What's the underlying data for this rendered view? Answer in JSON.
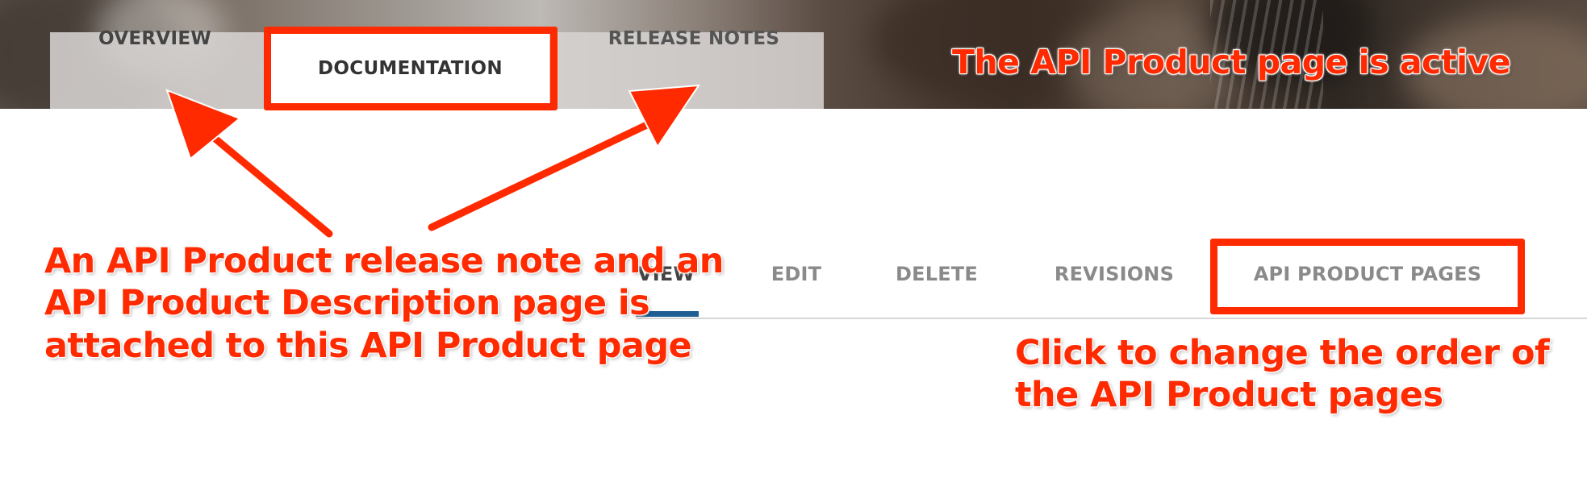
{
  "top_tabs": {
    "overview": "OVERVIEW",
    "documentation": "DOCUMENTATION",
    "release_notes": "RELEASE NOTES"
  },
  "secondary_tabs": {
    "view": "VIEW",
    "edit": "EDIT",
    "delete": "DELETE",
    "revisions": "REVISIONS",
    "api_product_pages": "API PRODUCT PAGES"
  },
  "annotations": {
    "active_page": "The API Product page is active",
    "attached": "An API Product release note and an\nAPI Product Description page is\nattached to this API Product page",
    "change_order": "Click to change the order of\nthe API Product pages"
  },
  "colors": {
    "annotation_red": "#ff2a00",
    "active_tab_underline": "#1f5f93",
    "tab_text": "#444444",
    "inactive_subtab_text": "#8a8a8a"
  },
  "icons": [
    "arrow-to-overview",
    "arrow-to-release-notes"
  ]
}
